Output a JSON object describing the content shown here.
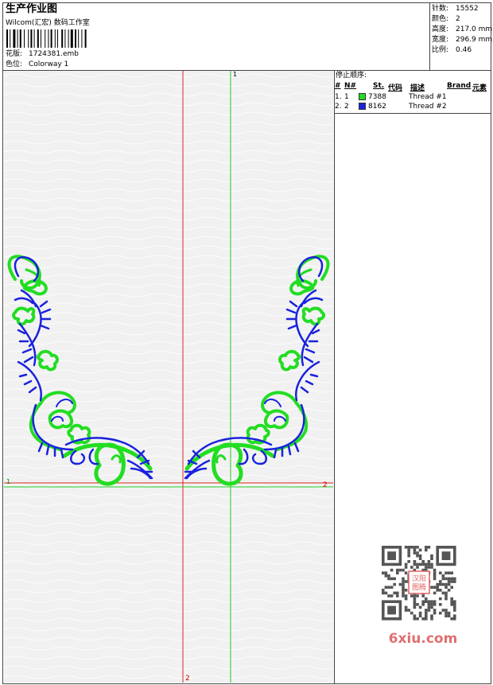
{
  "header": {
    "title": "生产作业图",
    "company": "Wilcom(汇宏) 数码工作室",
    "design_label": "花版:",
    "design_value": "1724381.emb",
    "colorway_label": "色位:",
    "colorway_value": "Colorway 1"
  },
  "stats": [
    {
      "label": "针数:",
      "value": "15552"
    },
    {
      "label": "颜色:",
      "value": "2"
    },
    {
      "label": "高度:",
      "value": "217.0 mm"
    },
    {
      "label": "宽度:",
      "value": "296.9 mm"
    },
    {
      "label": "比例:",
      "value": "0.46"
    }
  ],
  "stop_sequence": {
    "title": "停止顺序:",
    "columns": [
      "#",
      "N#",
      "St.",
      "代码",
      "描述",
      "Brand",
      "元素"
    ],
    "rows": [
      {
        "num": "1.",
        "n": "1",
        "color": "#22dd22",
        "code": "7388",
        "desc": "Thread #1"
      },
      {
        "num": "2.",
        "n": "2",
        "color": "#1a22dd",
        "code": "8162",
        "desc": "Thread #2"
      }
    ]
  },
  "canvas": {
    "axis_top": "1",
    "axis_left": "1",
    "axis_right": "2",
    "axis_bottom": "2",
    "green_color": "#22dd22",
    "blue_color": "#1a22dd",
    "crosshair_color": "#dd2222",
    "axis_color": "#22cc22"
  },
  "watermark": {
    "badge_line1": "汉阳",
    "badge_line2": "图腾",
    "site": "6xiu.com"
  }
}
